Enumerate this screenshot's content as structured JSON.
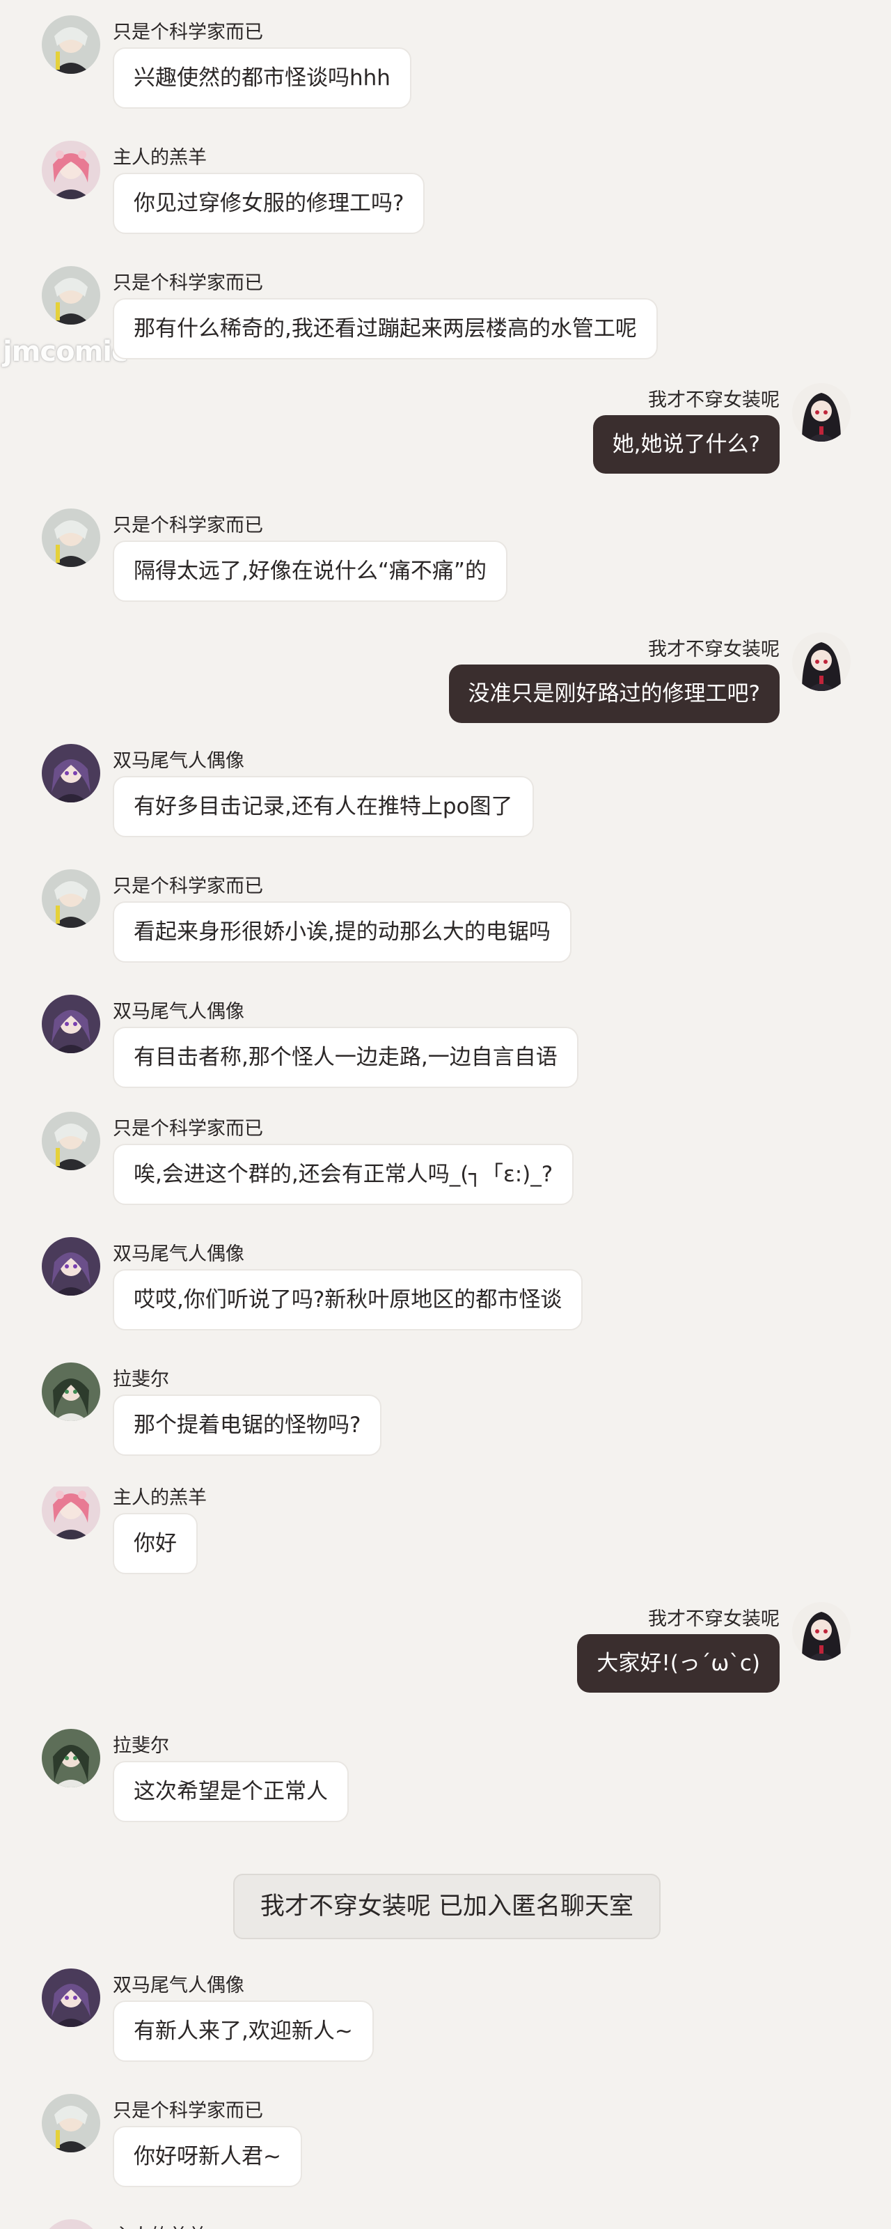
{
  "watermark": "jmcomic",
  "messages": [
    {
      "side": "left",
      "sender": "只是个科学家而已",
      "text": "兴趣使然的都市怪谈吗hhh",
      "avatar": "scientist-avatar"
    },
    {
      "side": "left",
      "sender": "主人的羔羊",
      "text": "你见过穿修女服的修理工吗?",
      "avatar": "lamb-avatar"
    },
    {
      "side": "left",
      "sender": "只是个科学家而已",
      "text": "那有什么稀奇的,我还看过蹦起来两层楼高的水管工呢",
      "avatar": "scientist-avatar"
    },
    {
      "side": "right",
      "sender": "我才不穿女装呢",
      "text": "她,她说了什么?",
      "avatar": "self-avatar"
    },
    {
      "side": "left",
      "sender": "只是个科学家而已",
      "text": "隔得太远了,好像在说什么“痛不痛”的",
      "avatar": "scientist-avatar"
    },
    {
      "side": "right",
      "sender": "我才不穿女装呢",
      "text": "没准只是刚好路过的修理工吧?",
      "avatar": "self-avatar"
    },
    {
      "side": "left",
      "sender": "双马尾气人偶像",
      "text": "有好多目击记录,还有人在推特上po图了",
      "avatar": "idol-avatar"
    },
    {
      "side": "left",
      "sender": "只是个科学家而已",
      "text": "看起来身形很娇小诶,提的动那么大的电锯吗",
      "avatar": "scientist-avatar"
    },
    {
      "side": "left",
      "sender": "双马尾气人偶像",
      "text": "有目击者称,那个怪人一边走路,一边自言自语",
      "avatar": "idol-avatar"
    },
    {
      "side": "left",
      "sender": "只是个科学家而已",
      "text": "唉,会进这个群的,还会有正常人吗_(┐「ε:)_?",
      "avatar": "scientist-avatar"
    },
    {
      "side": "left",
      "sender": "双马尾气人偶像",
      "text": "哎哎,你们听说了吗?新秋叶原地区的都市怪谈",
      "avatar": "idol-avatar"
    },
    {
      "side": "left",
      "sender": "拉斐尔",
      "text": "那个提着电锯的怪物吗?",
      "avatar": "raphael-avatar"
    },
    {
      "side": "left",
      "sender": "主人的羔羊",
      "text": "你好",
      "avatar": "lamb-avatar"
    },
    {
      "side": "right",
      "sender": "我才不穿女装呢",
      "text": "大家好!(っ´ω`c)",
      "avatar": "self-avatar"
    },
    {
      "side": "left",
      "sender": "拉斐尔",
      "text": "这次希望是个正常人",
      "avatar": "raphael-avatar"
    },
    {
      "side": "left",
      "sender": "双马尾气人偶像",
      "text": "有新人来了,欢迎新人~",
      "avatar": "idol-avatar"
    },
    {
      "side": "left",
      "sender": "只是个科学家而已",
      "text": "你好呀新人君~",
      "avatar": "scientist-avatar"
    }
  ],
  "system_notice": "我才不穿女装呢 已加入匿名聊天室",
  "partial_bottom_sender": "主人的羔羊",
  "colors": {
    "background": "#f4f2ef",
    "incoming_bubble": "#ffffff",
    "outgoing_bubble": "#3a2e2e",
    "outgoing_text": "#ffffff",
    "system_bubble": "#ebe9e6"
  }
}
